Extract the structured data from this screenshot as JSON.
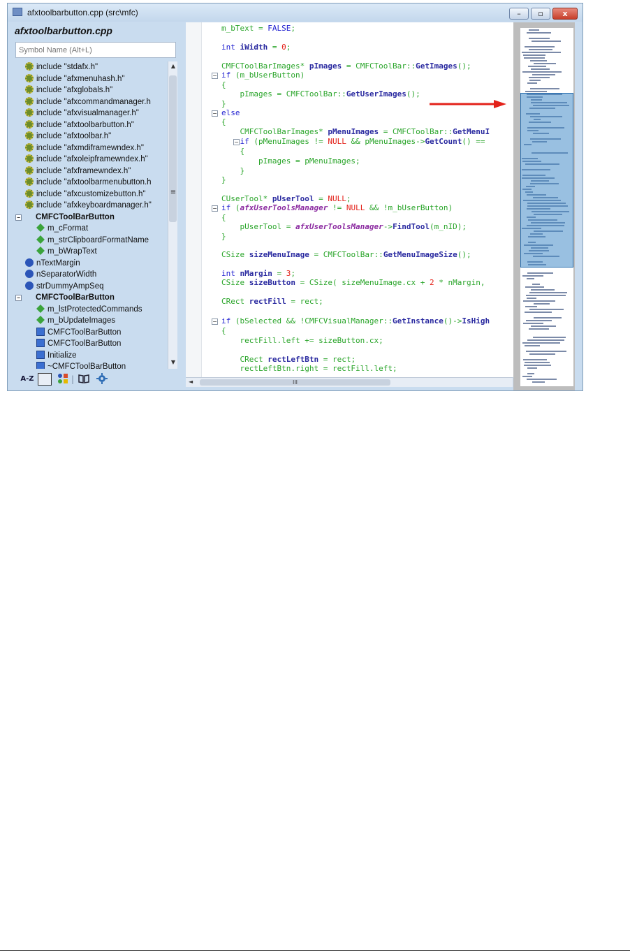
{
  "window": {
    "title": "afxtoolbarbutton.cpp (src\\mfc)",
    "controls": {
      "minimize": "–",
      "maximize": "▫",
      "close": "x"
    }
  },
  "sidebar": {
    "file_heading": "afxtoolbarbutton.cpp",
    "search_placeholder": "Symbol Name (Alt+L)",
    "items": [
      {
        "label": "include \"stdafx.h\"",
        "kind": "include-icon",
        "level": 1
      },
      {
        "label": "include \"afxmenuhash.h\"",
        "kind": "include-icon",
        "level": 1
      },
      {
        "label": "include \"afxglobals.h\"",
        "kind": "include-icon",
        "level": 1
      },
      {
        "label": "include \"afxcommandmanager.h",
        "kind": "include-icon",
        "level": 1
      },
      {
        "label": "include \"afxvisualmanager.h\"",
        "kind": "include-icon",
        "level": 1
      },
      {
        "label": "include \"afxtoolbarbutton.h\"",
        "kind": "include-icon",
        "level": 1
      },
      {
        "label": "include \"afxtoolbar.h\"",
        "kind": "include-icon",
        "level": 1
      },
      {
        "label": "include \"afxmdiframewndex.h\"",
        "kind": "include-icon",
        "level": 1
      },
      {
        "label": "include \"afxoleipframewndex.h\"",
        "kind": "include-icon",
        "level": 1
      },
      {
        "label": "include \"afxframewndex.h\"",
        "kind": "include-icon",
        "level": 1
      },
      {
        "label": "include \"afxtoolbarmenubutton.h",
        "kind": "include-icon",
        "level": 1
      },
      {
        "label": "include \"afxcustomizebutton.h\"",
        "kind": "include-icon",
        "level": 1
      },
      {
        "label": "include \"afxkeyboardmanager.h\"",
        "kind": "include-icon",
        "level": 1
      },
      {
        "label": "CMFCToolBarButton",
        "kind": "class-icon",
        "level": 0,
        "bold": true
      },
      {
        "label": "m_cFormat",
        "kind": "member-icon",
        "level": 2
      },
      {
        "label": "m_strClipboardFormatName",
        "kind": "member-icon",
        "level": 2
      },
      {
        "label": "m_bWrapText",
        "kind": "member-icon",
        "level": 2
      },
      {
        "label": "nTextMargin",
        "kind": "field-icon",
        "level": 1
      },
      {
        "label": "nSeparatorWidth",
        "kind": "field-icon",
        "level": 1
      },
      {
        "label": "strDummyAmpSeq",
        "kind": "field-icon",
        "level": 1
      },
      {
        "label": "CMFCToolBarButton",
        "kind": "class-icon",
        "level": 0,
        "bold": true
      },
      {
        "label": "m_lstProtectedCommands",
        "kind": "member-icon",
        "level": 2
      },
      {
        "label": "m_bUpdateImages",
        "kind": "member-icon",
        "level": 2
      },
      {
        "label": "CMFCToolBarButton",
        "kind": "method-icon",
        "level": 2
      },
      {
        "label": "CMFCToolBarButton",
        "kind": "method-icon",
        "level": 2
      },
      {
        "label": "Initialize",
        "kind": "method-icon",
        "level": 2
      },
      {
        "label": "~CMFCToolBarButton",
        "kind": "method-icon",
        "level": 2
      }
    ],
    "scroll_up": "▲",
    "scroll_down": "▼",
    "grip": "≡",
    "toolbar": {
      "sort_az": "A-Z",
      "splitter": "|"
    }
  },
  "editor": {
    "collapse_glyph": "−",
    "hscroll_glyph": "III",
    "hscroll_left": "◄"
  },
  "colors": {
    "window_frame": "#c9dcef",
    "close_button": "#c63e2a",
    "keyword": "#1f1fd0",
    "code_text": "#2aa52a",
    "number": "#e3221a",
    "annotation_arrow": "#e3221a"
  }
}
